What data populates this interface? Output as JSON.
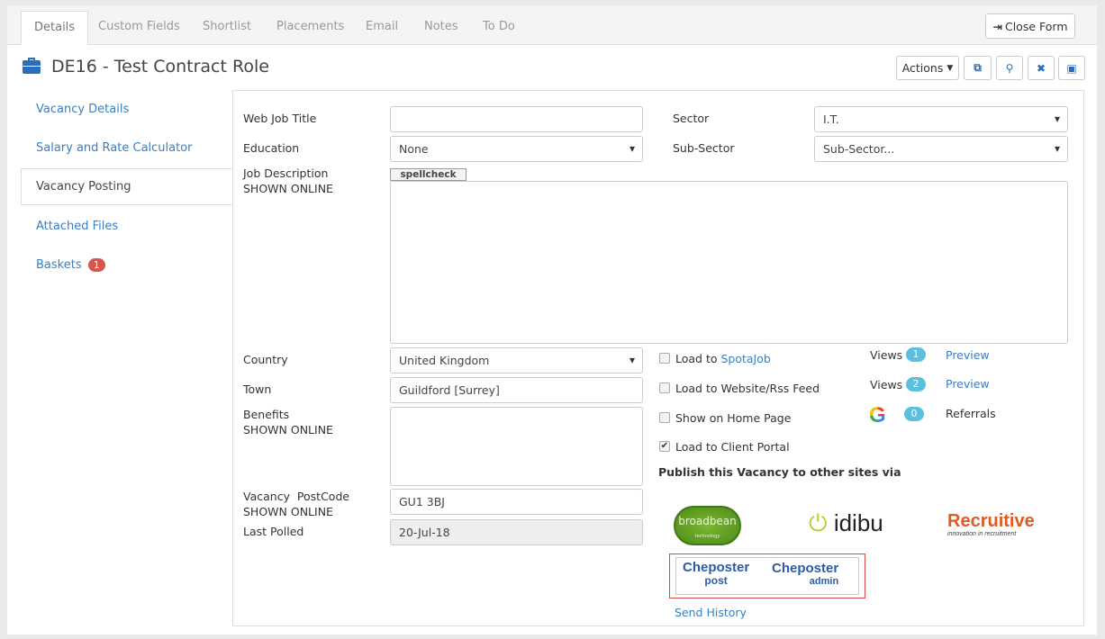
{
  "tabs": [
    {
      "label": "Details",
      "active": true
    },
    {
      "label": "Custom Fields"
    },
    {
      "label": "Shortlist"
    },
    {
      "label": "Placements"
    },
    {
      "label": "Email"
    },
    {
      "label": "Notes"
    },
    {
      "label": "To Do"
    }
  ],
  "close_form": "Close Form",
  "title": "DE16 - Test Contract Role",
  "toolbar": {
    "actions": "Actions",
    "icons": [
      "copy-icon",
      "search-icon",
      "close-icon",
      "save-icon"
    ]
  },
  "sidenav": [
    {
      "label": "Vacancy Details"
    },
    {
      "label": "Salary and Rate Calculator"
    },
    {
      "label": "Vacancy Posting",
      "active": true
    },
    {
      "label": "Attached Files"
    },
    {
      "label": "Baskets",
      "badge": "1"
    }
  ],
  "form": {
    "web_job_title": {
      "label": "Web Job Title",
      "value": ""
    },
    "sector": {
      "label": "Sector",
      "value": "I.T."
    },
    "education": {
      "label": "Education",
      "value": "None"
    },
    "sub_sector": {
      "label": "Sub-Sector",
      "value": "Sub-Sector..."
    },
    "job_description": {
      "label": "Job Description",
      "sub": "SHOWN ONLINE",
      "spellcheck": "spellcheck",
      "value": ""
    },
    "country": {
      "label": "Country",
      "value": "United Kingdom"
    },
    "town": {
      "label": "Town",
      "value": "Guildford [Surrey]"
    },
    "benefits": {
      "label": "Benefits",
      "sub": "SHOWN ONLINE",
      "value": ""
    },
    "postcode": {
      "label": "Vacancy  PostCode",
      "sub": "SHOWN ONLINE",
      "value": "GU1 3BJ"
    },
    "last_polled": {
      "label": "Last Polled",
      "value": "20-Jul-18"
    }
  },
  "options": [
    {
      "prefix": "Load to ",
      "link": "SpotaJob",
      "checked": false
    },
    {
      "prefix": "Load to Website/Rss Feed",
      "checked": false
    },
    {
      "prefix": "Show on Home Page",
      "checked": false
    },
    {
      "prefix": "Load to Client Portal",
      "checked": true
    }
  ],
  "stats": [
    {
      "label": "Views",
      "count": "1",
      "action": "Preview"
    },
    {
      "label": "Views",
      "count": "2",
      "action": "Preview"
    },
    {
      "icon": "google-icon",
      "count": "0",
      "action": "Referrals"
    }
  ],
  "publish": {
    "heading": "Publish this Vacancy to other sites via",
    "logos": [
      "broadbean",
      "idibu",
      "Recruitive"
    ],
    "broadbean_sub": "technology",
    "recruitive_sub": "innovation in recruitment",
    "chloposter": [
      {
        "top": "Cheposter",
        "bottom": "post"
      },
      {
        "top": "Cheposter",
        "bottom": "admin"
      }
    ],
    "send_history": "Send History"
  },
  "colors": {
    "accent": "#3a7fc1",
    "badge_red": "#d9534f",
    "badge_info": "#5bc0de",
    "highlight": "#e0474c"
  }
}
